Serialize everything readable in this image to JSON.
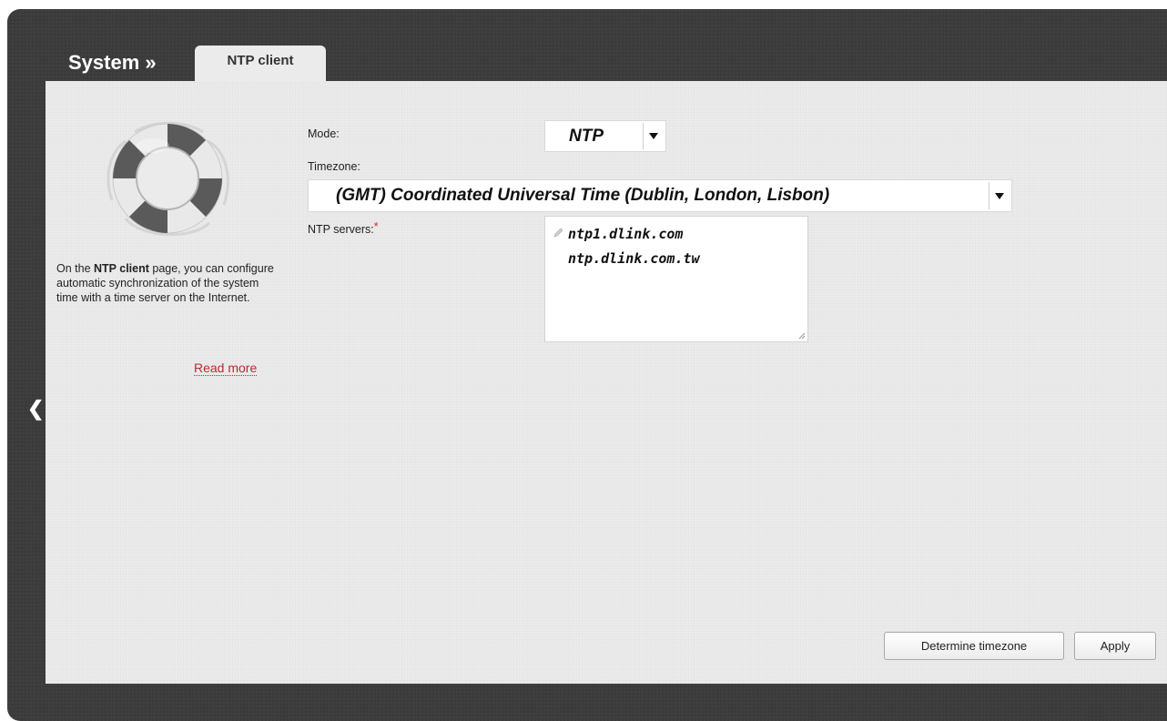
{
  "header": {
    "title": "System »",
    "tab_label": "NTP client"
  },
  "sidebar": {
    "desc_prefix": "On the ",
    "desc_bold": "NTP client",
    "desc_suffix": " page, you can configure automatic synchronization of the system time with a time server on the Internet.",
    "read_more": "Read more"
  },
  "form": {
    "mode": {
      "label": "Mode:",
      "value": "NTP"
    },
    "timezone": {
      "label": "Timezone:",
      "value": "(GMT) Coordinated Universal Time (Dublin, London, Lisbon)"
    },
    "ntp_servers": {
      "label": "NTP servers:",
      "required_mark": "*",
      "values": [
        "ntp1.dlink.com",
        "ntp.dlink.com.tw"
      ]
    }
  },
  "buttons": {
    "determine_timezone": "Determine timezone",
    "apply": "Apply"
  },
  "icons": {
    "back": "back-arrow-icon",
    "hero": "lifebuoy-icon",
    "edit": "pencil-icon"
  },
  "colors": {
    "frame": "#3b3b3b",
    "panel": "#ebebeb",
    "link": "#c1272d",
    "required": "#e0262f"
  }
}
